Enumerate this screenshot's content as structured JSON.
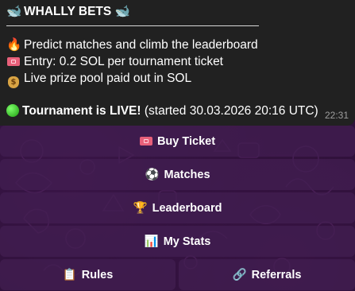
{
  "message": {
    "title": "WHALLY BETS",
    "title_icon_left": "whale-icon",
    "title_icon_right": "whale-icon",
    "lines": [
      {
        "icon": "fire-icon",
        "text": "Predict matches and climb the leaderboard"
      },
      {
        "icon": "ticket-icon",
        "text": "Entry: 0.2 SOL per tournament ticket"
      },
      {
        "icon": "money-bag-icon",
        "text": "Live prize pool paid out in SOL"
      }
    ],
    "status": {
      "icon": "green-circle-icon",
      "label": "Tournament is LIVE!",
      "detail": "(started 30.03.2026 20:16 UTC)"
    },
    "time": "22:31"
  },
  "keyboard": {
    "buy_ticket": {
      "icon": "ticket-icon",
      "label": "Buy Ticket"
    },
    "matches": {
      "icon": "soccer-ball-icon",
      "label": "Matches"
    },
    "leaderboard": {
      "icon": "trophy-icon",
      "label": "Leaderboard"
    },
    "my_stats": {
      "icon": "bar-chart-icon",
      "label": "My Stats"
    },
    "rules": {
      "icon": "clipboard-icon",
      "label": "Rules"
    },
    "referrals": {
      "icon": "link-icon",
      "label": "Referrals"
    }
  },
  "colors": {
    "chat_background": "#2c1036",
    "bubble": "#212121",
    "button": "#421e52",
    "timestamp": "#9e9e9e"
  }
}
